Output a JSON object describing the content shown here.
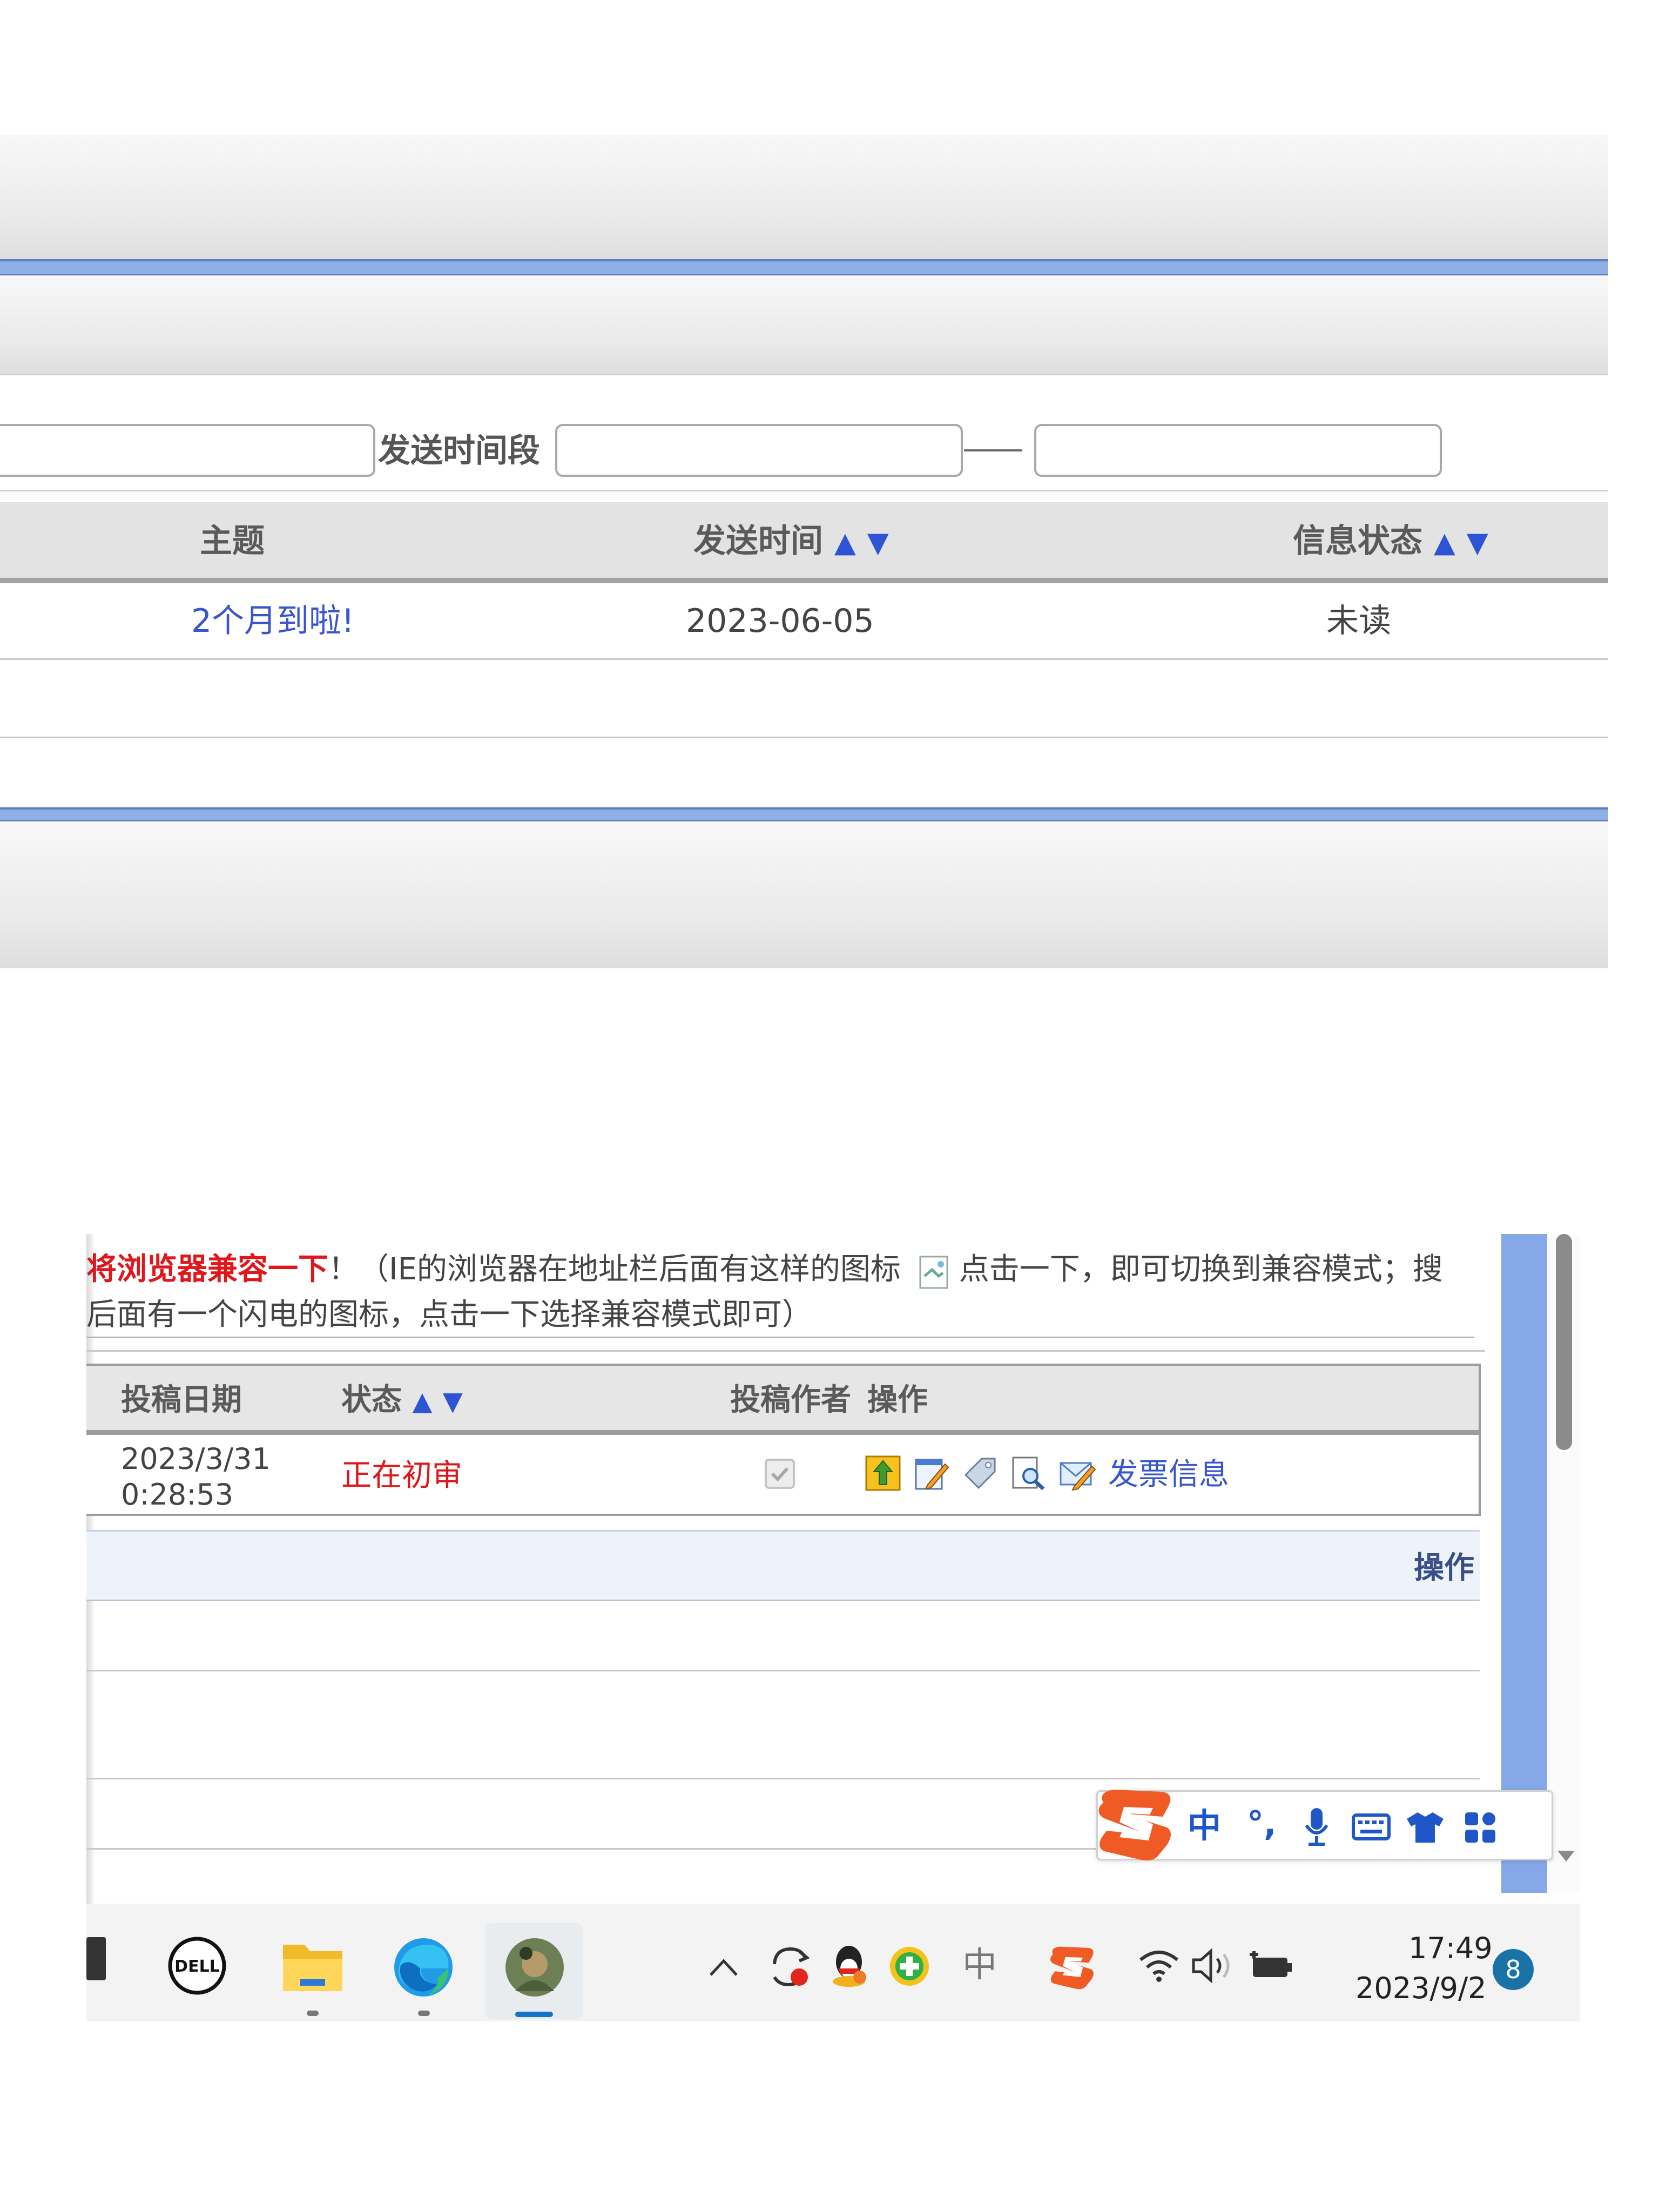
{
  "messages_panel": {
    "search": {
      "send_period_label": "发送时间段",
      "range_dash": "—",
      "keyword_value": "",
      "start_value": "",
      "end_value": ""
    },
    "columns": {
      "subject": "主题",
      "send_time": "发送时间",
      "status": "信息状态",
      "sort_up": "▲",
      "sort_down": "▼"
    },
    "rows": [
      {
        "subject": "2个月到啦!",
        "send_time": "2023-06-05",
        "status": "未读"
      }
    ]
  },
  "submissions_panel": {
    "notice_line1_red": "将浏览器兼容一下",
    "notice_line1_rest": "！（IE的浏览器在地址栏后面有这样的图标",
    "notice_line1_after": "点击一下，即可切换到兼容模式；搜",
    "notice_line2": "后面有一个闪电的图标，点击一下选择兼容模式即可）",
    "columns": {
      "date": "投稿日期",
      "status": "状态",
      "sort_up": "▲",
      "sort_down": "▼",
      "author": "投稿作者",
      "actions": "操作"
    },
    "rows": [
      {
        "date_line1": "2023/3/31",
        "date_line2": "0:28:53",
        "status": "正在初审",
        "author_checked": true,
        "invoice_link": "发票信息"
      }
    ],
    "second_table_header": "操作"
  },
  "ime_toolbar": {
    "mode": "中",
    "punct": "°,"
  },
  "taskbar": {
    "tray_lang": "中",
    "time": "17:49",
    "date": "2023/9/2",
    "notification_count": "8"
  },
  "colors": {
    "accent_blue": "#3a56cc",
    "rule_blue": "#8fb0e6",
    "status_red": "#e1161b",
    "sogou_orange": "#f05a24"
  }
}
